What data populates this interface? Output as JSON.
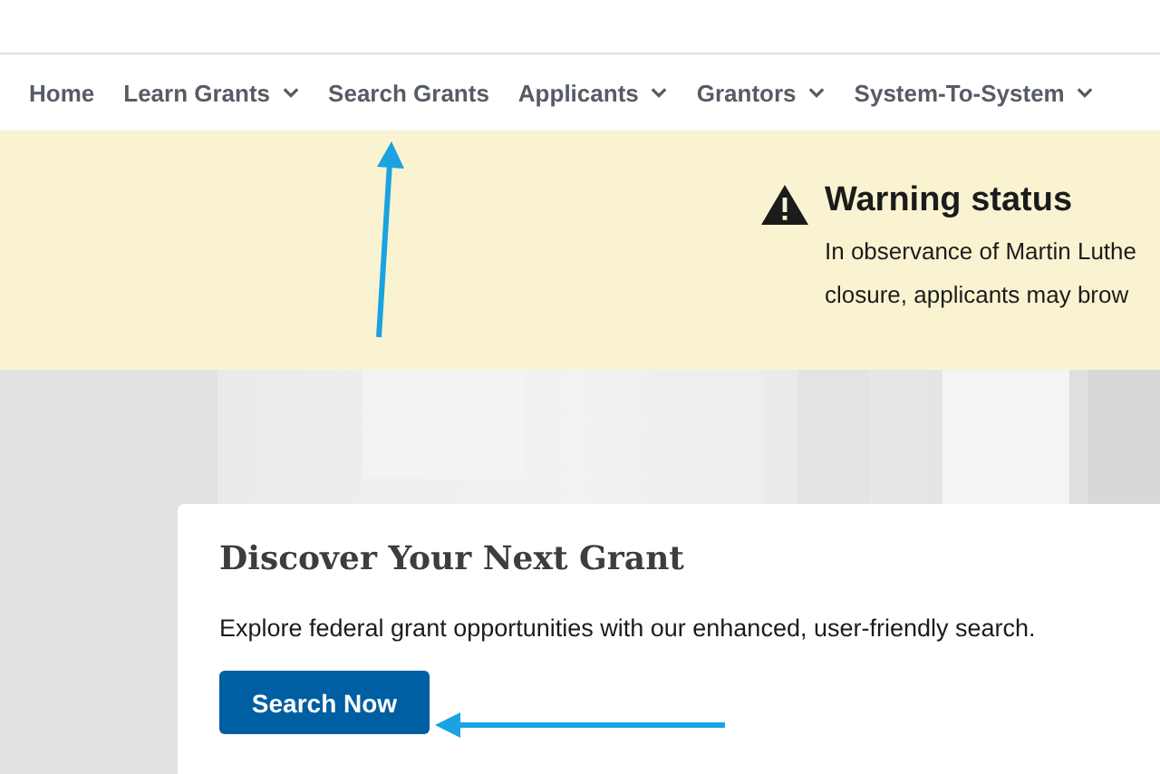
{
  "nav": {
    "items": [
      {
        "label": "Home",
        "has_dropdown": false
      },
      {
        "label": "Learn Grants",
        "has_dropdown": true
      },
      {
        "label": "Search Grants",
        "has_dropdown": false
      },
      {
        "label": "Applicants",
        "has_dropdown": true
      },
      {
        "label": "Grantors",
        "has_dropdown": true
      },
      {
        "label": "System-To-System",
        "has_dropdown": true
      }
    ]
  },
  "alert": {
    "title": "Warning status",
    "lines": [
      "In observance of Martin Luthe",
      "closure, applicants may brow"
    ]
  },
  "hero": {
    "kind": "picture",
    "card": {
      "title": "Discover Your Next Grant",
      "text": "Explore federal grant opportunities with our enhanced, user-friendly search.",
      "button": "Search Now"
    }
  }
}
